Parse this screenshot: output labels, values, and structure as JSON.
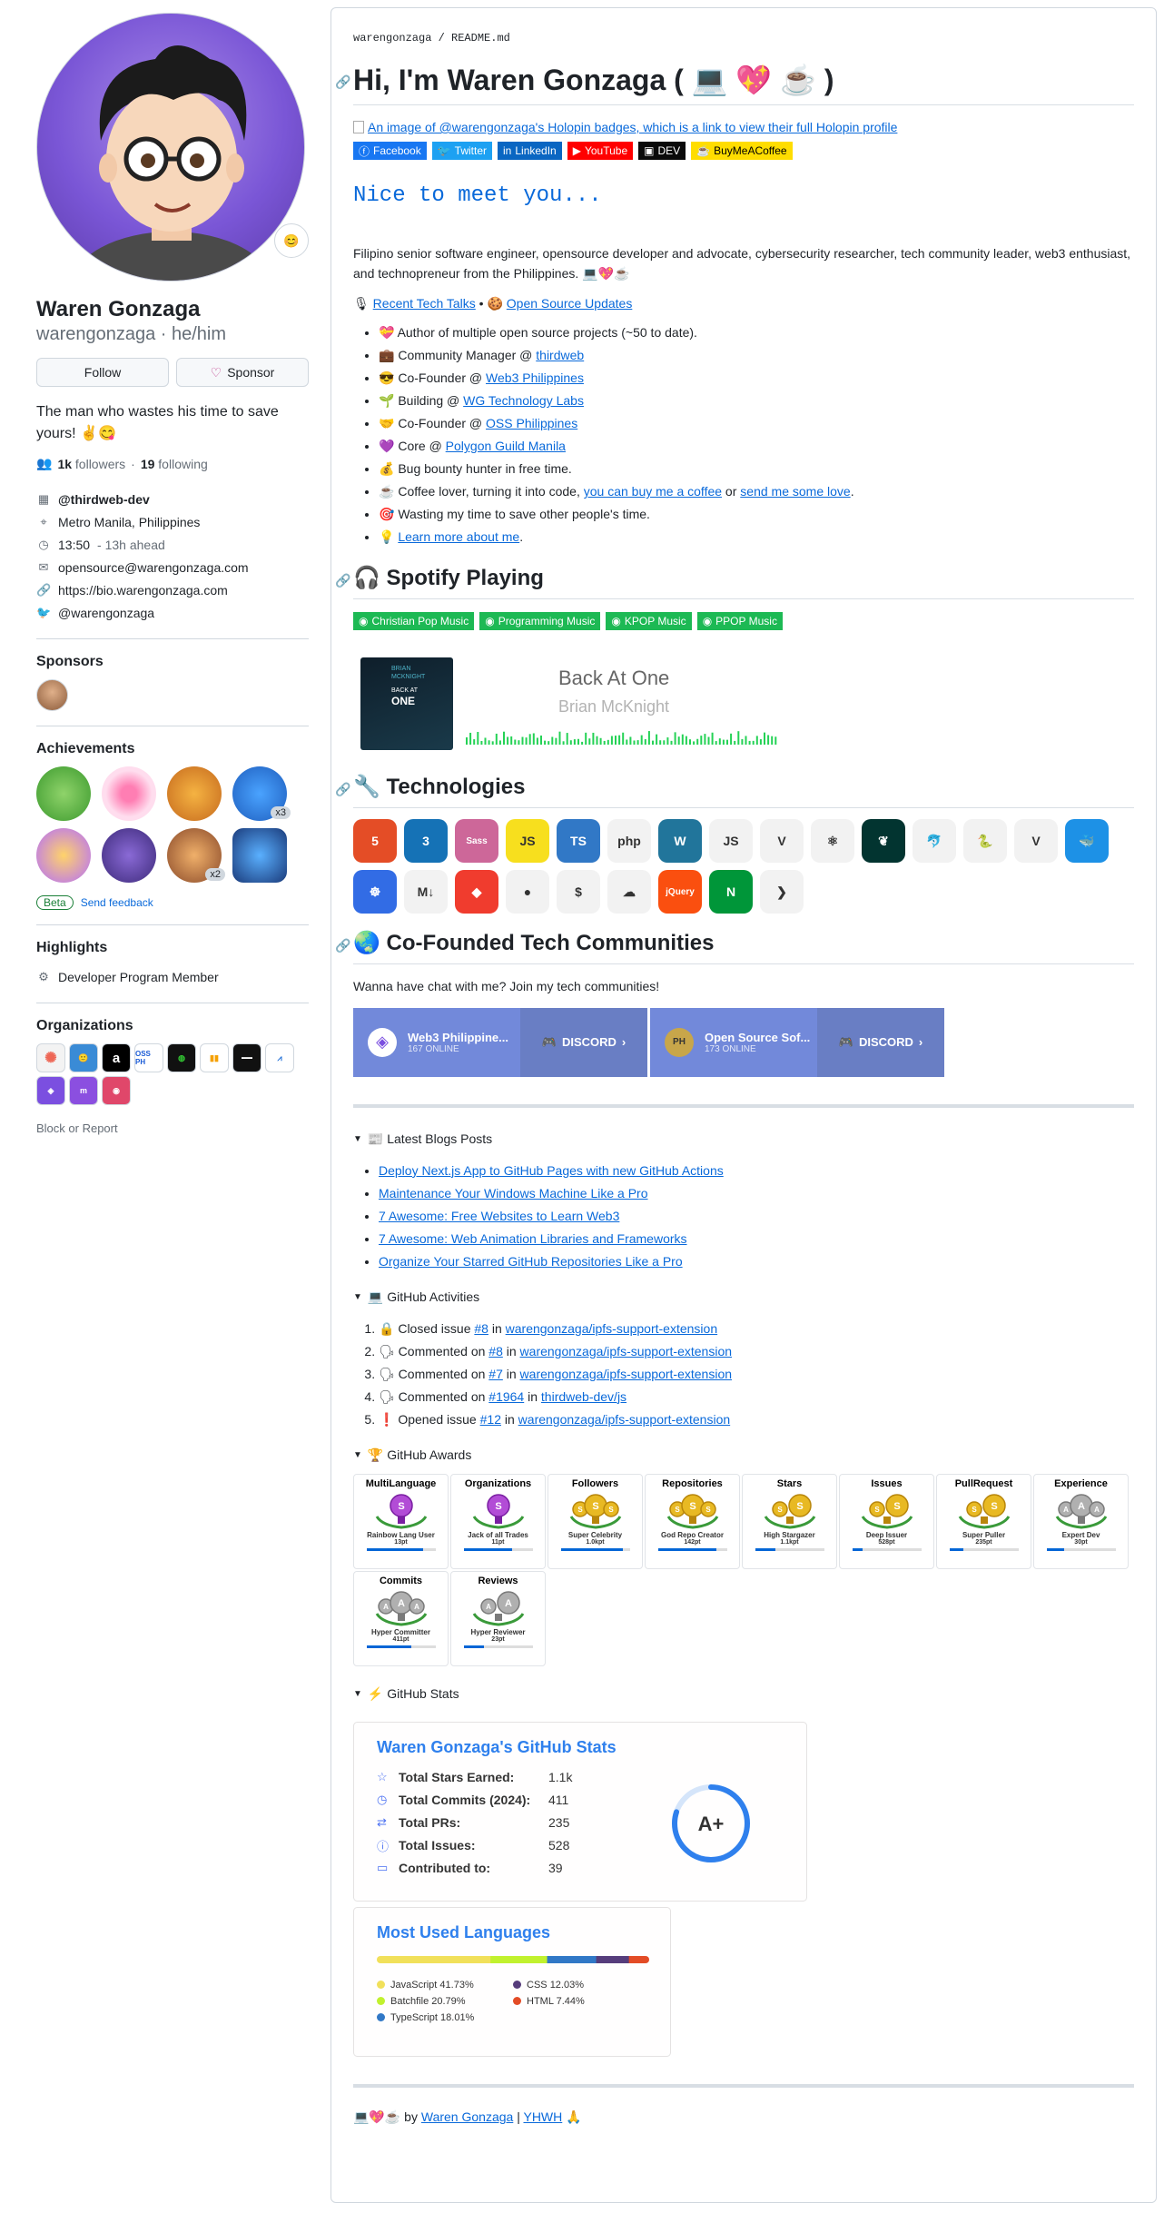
{
  "profile": {
    "status_emoji": "😊",
    "fullname": "Waren Gonzaga",
    "login": "warengonzaga · he/him",
    "follow_button": "Follow",
    "sponsor_button": "Sponsor",
    "bio": "The man who wastes his time to save yours! ✌️😋",
    "followers_count": "1k",
    "followers_label": "followers",
    "following_count": "19",
    "following_label": "following",
    "details": [
      {
        "icon": "org-icon",
        "text": "@thirdweb-dev",
        "bold": true
      },
      {
        "icon": "location-icon",
        "text": "Metro Manila, Philippines"
      },
      {
        "icon": "clock-icon",
        "text": "13:50",
        "muted": "- 13h ahead"
      },
      {
        "icon": "mail-icon",
        "text": "opensource@warengonzaga.com"
      },
      {
        "icon": "link-icon",
        "text": "https://bio.warengonzaga.com"
      },
      {
        "icon": "twitter-icon",
        "text": "@warengonzaga"
      }
    ],
    "sponsors_title": "Sponsors",
    "achievements_title": "Achievements",
    "achievement_counts": [
      "x3",
      "x2"
    ],
    "beta_label": "Beta",
    "feedback_link": "Send feedback",
    "highlights_title": "Highlights",
    "highlight": "Developer Program Member",
    "organizations_title": "Organizations",
    "org_labels": [
      "OSS PH"
    ],
    "block_report": "Block or Report"
  },
  "readme": {
    "breadcrumb_owner": "warengonzaga",
    "breadcrumb_sep": " / ",
    "breadcrumb_file": "README.md",
    "title": "Hi, I'm Waren Gonzaga ( 💻 💖 ☕ )",
    "holopin_alt": "An image of @warengonzaga's Holopin badges, which is a link to view their full Holopin profile",
    "shields": [
      {
        "label": "Facebook",
        "color": "#1877f2"
      },
      {
        "label": "Twitter",
        "color": "#1da1f2"
      },
      {
        "label": "LinkedIn",
        "color": "#0a66c2"
      },
      {
        "label": "YouTube",
        "color": "#ff0000"
      },
      {
        "label": "DEV",
        "color": "#0a0a0a"
      },
      {
        "label": "BuyMeACoffee",
        "color": "#ffdd00"
      }
    ],
    "nice_to_meet": "Nice to meet you...",
    "intro": "Filipino senior software engineer, opensource developer and advocate, cybersecurity researcher, tech community leader, web3 enthusiast, and technopreneur from the Philippines. 💻💖☕",
    "recent_talks": "Recent Tech Talks",
    "bullet_sep": " • ",
    "oss_updates": "Open Source Updates",
    "bullets": [
      {
        "emoji": "💝",
        "text": "Author of multiple open source projects (~50 to date)."
      },
      {
        "emoji": "💼",
        "text": "Community Manager @ ",
        "link": "thirdweb"
      },
      {
        "emoji": "😎",
        "text": "Co-Founder @ ",
        "link": "Web3 Philippines"
      },
      {
        "emoji": "🌱",
        "text": "Building @ ",
        "link": "WG Technology Labs"
      },
      {
        "emoji": "🤝",
        "text": "Co-Founder @ ",
        "link": "OSS Philippines"
      },
      {
        "emoji": "💜",
        "text": "Core @ ",
        "link": "Polygon Guild Manila"
      },
      {
        "emoji": "💰",
        "text": "Bug bounty hunter in free time."
      },
      {
        "emoji": "☕",
        "text": "Coffee lover, turning it into code, ",
        "link": "you can buy me a coffee",
        "text2": " or ",
        "link2": "send me some love",
        "text3": "."
      },
      {
        "emoji": "🎯",
        "text": "Wasting my time to save other people's time."
      },
      {
        "emoji": "💡",
        "text": "",
        "link": "Learn more about me",
        "text3": "."
      }
    ],
    "spotify_title": "🎧 Spotify Playing",
    "spotify_badges": [
      "Christian Pop Music",
      "Programming Music",
      "KPOP Music",
      "PPOP Music"
    ],
    "song_title": "Back At One",
    "song_artist": "Brian McKnight",
    "album_text": [
      "BRIAN",
      "MCKNIGHT",
      "BACK AT",
      "ONE"
    ],
    "tech_title": "🔧 Technologies",
    "technologies": [
      {
        "name": "html5-icon",
        "label": "5",
        "color": "#e44d26"
      },
      {
        "name": "css3-icon",
        "label": "3",
        "color": "#1572b6"
      },
      {
        "name": "sass-icon",
        "label": "Sass",
        "color": "#cd6799"
      },
      {
        "name": "javascript-icon",
        "label": "JS",
        "color": "#f7df1e"
      },
      {
        "name": "typescript-icon",
        "label": "TS",
        "color": "#3178c6"
      },
      {
        "name": "php-icon",
        "label": "php",
        "color": "#f2f2f2"
      },
      {
        "name": "wordpress-icon",
        "label": "W",
        "color": "#21759b"
      },
      {
        "name": "nodejs-icon",
        "label": "JS",
        "color": "#f2f2f2"
      },
      {
        "name": "vue-icon",
        "label": "V",
        "color": "#f2f2f2"
      },
      {
        "name": "react-icon",
        "label": "⚛",
        "color": "#f2f2f2"
      },
      {
        "name": "mongodb-icon",
        "label": "❦",
        "color": "#023430"
      },
      {
        "name": "mysql-icon",
        "label": "🐬",
        "color": "#f2f2f2"
      },
      {
        "name": "python-icon",
        "label": "🐍",
        "color": "#f2f2f2"
      },
      {
        "name": "vim-icon",
        "label": "V",
        "color": "#f2f2f2"
      },
      {
        "name": "docker-icon",
        "label": "🐳",
        "color": "#1d91e6"
      },
      {
        "name": "kubernetes-icon",
        "label": "☸",
        "color": "#326ce5"
      },
      {
        "name": "markdown-icon",
        "label": "M↓",
        "color": "#f2f2f2"
      },
      {
        "name": "git-icon",
        "label": "◆",
        "color": "#f03c2e"
      },
      {
        "name": "figma-icon",
        "label": "●",
        "color": "#f2f2f2"
      },
      {
        "name": "aws-cli-icon",
        "label": "$",
        "color": "#f2f2f2"
      },
      {
        "name": "cloudflare-icon",
        "label": "☁",
        "color": "#f2f2f2"
      },
      {
        "name": "jquery-icon",
        "label": "jQuery",
        "color": "#fa4f0f"
      },
      {
        "name": "nginx-icon",
        "label": "N",
        "color": "#009639"
      },
      {
        "name": "vscode-icon",
        "label": "❯",
        "color": "#f2f2f2"
      }
    ],
    "communities_title": "🌏 Co-Founded Tech Communities",
    "communities_intro": "Wanna have chat with me? Join my tech communities!",
    "discord": [
      {
        "name": "Web3 Philippine...",
        "online": "167 ONLINE"
      },
      {
        "name": "Open Source Sof...",
        "online": "173 ONLINE"
      }
    ],
    "discord_label": "DISCORD",
    "blogs_title": "📰 Latest Blogs Posts",
    "blogs": [
      "Deploy Next.js App to GitHub Pages with new GitHub Actions",
      "Maintenance Your Windows Machine Like a Pro",
      "7 Awesome: Free Websites to Learn Web3",
      "7 Awesome: Web Animation Libraries and Frameworks",
      "Organize Your Starred GitHub Repositories Like a Pro"
    ],
    "activities_title": "💻 GitHub Activities",
    "activities": [
      {
        "emoji": "🔒",
        "action": "Closed issue ",
        "ref": "#8",
        "in": " in ",
        "repo": "warengonzaga/ipfs-support-extension"
      },
      {
        "emoji": "🗣",
        "action": "Commented on ",
        "ref": "#8",
        "in": " in ",
        "repo": "warengonzaga/ipfs-support-extension"
      },
      {
        "emoji": "🗣",
        "action": "Commented on ",
        "ref": "#7",
        "in": " in ",
        "repo": "warengonzaga/ipfs-support-extension"
      },
      {
        "emoji": "🗣",
        "action": "Commented on ",
        "ref": "#1964",
        "in": " in ",
        "repo": "thirdweb-dev/js"
      },
      {
        "emoji": "❗",
        "action": "Opened issue ",
        "ref": "#12",
        "in": " in ",
        "repo": "warengonzaga/ipfs-support-extension"
      }
    ],
    "awards_title": "🏆 GitHub Awards",
    "awards": [
      {
        "title": "MultiLanguage",
        "rank": "S",
        "name": "Rainbow Lang User",
        "points": "13pt",
        "progress": 0.82,
        "color": "purple"
      },
      {
        "title": "Organizations",
        "rank": "S",
        "name": "Jack of all Trades",
        "points": "11pt",
        "progress": 0.7,
        "color": "purple"
      },
      {
        "title": "Followers",
        "rank": "SSS",
        "name": "Super Celebrity",
        "points": "1.0kpt",
        "progress": 0.9,
        "color": "gold"
      },
      {
        "title": "Repositories",
        "rank": "SSS",
        "name": "God Repo Creator",
        "points": "142pt",
        "progress": 0.85,
        "color": "gold"
      },
      {
        "title": "Stars",
        "rank": "SS",
        "name": "High Stargazer",
        "points": "1.1kpt",
        "progress": 0.3,
        "color": "gold"
      },
      {
        "title": "Issues",
        "rank": "SS",
        "name": "Deep Issuer",
        "points": "528pt",
        "progress": 0.15,
        "color": "gold"
      },
      {
        "title": "PullRequest",
        "rank": "SS",
        "name": "Super Puller",
        "points": "235pt",
        "progress": 0.2,
        "color": "gold"
      },
      {
        "title": "Experience",
        "rank": "AAA",
        "name": "Expert Dev",
        "points": "30pt",
        "progress": 0.25,
        "color": "silver"
      },
      {
        "title": "Commits",
        "rank": "AAA",
        "name": "Hyper Committer",
        "points": "411pt",
        "progress": 0.65,
        "color": "silver"
      },
      {
        "title": "Reviews",
        "rank": "AA",
        "name": "Hyper Reviewer",
        "points": "23pt",
        "progress": 0.3,
        "color": "silver"
      }
    ],
    "stats_title_section": "⚡ GitHub Stats",
    "stats": {
      "title": "Waren Gonzaga's GitHub Stats",
      "rows": [
        {
          "icon": "star-icon",
          "label": "Total Stars Earned:",
          "value": "1.1k"
        },
        {
          "icon": "commit-history-icon",
          "label": "Total Commits (2024):",
          "value": "411"
        },
        {
          "icon": "pull-request-icon",
          "label": "Total PRs:",
          "value": "235"
        },
        {
          "icon": "issue-icon",
          "label": "Total Issues:",
          "value": "528"
        },
        {
          "icon": "repo-icon",
          "label": "Contributed to:",
          "value": "39"
        }
      ],
      "grade": "A+",
      "grade_progress": 0.8
    },
    "languages": {
      "title": "Most Used Languages",
      "items": [
        {
          "name": "JavaScript",
          "percent": "41.73%",
          "value": 41.73,
          "color": "#f1e05a"
        },
        {
          "name": "Batchfile",
          "percent": "20.79%",
          "value": 20.79,
          "color": "#c1f12e"
        },
        {
          "name": "TypeScript",
          "percent": "18.01%",
          "value": 18.01,
          "color": "#3178c6"
        },
        {
          "name": "CSS",
          "percent": "12.03%",
          "value": 12.03,
          "color": "#563d7c"
        },
        {
          "name": "HTML",
          "percent": "7.44%",
          "value": 7.44,
          "color": "#e34c26"
        }
      ]
    },
    "footer_prefix": "💻💖☕ by ",
    "footer_author": "Waren Gonzaga",
    "footer_sep": " | ",
    "footer_yhwh": "YHWH",
    "footer_suffix": " 🙏"
  }
}
